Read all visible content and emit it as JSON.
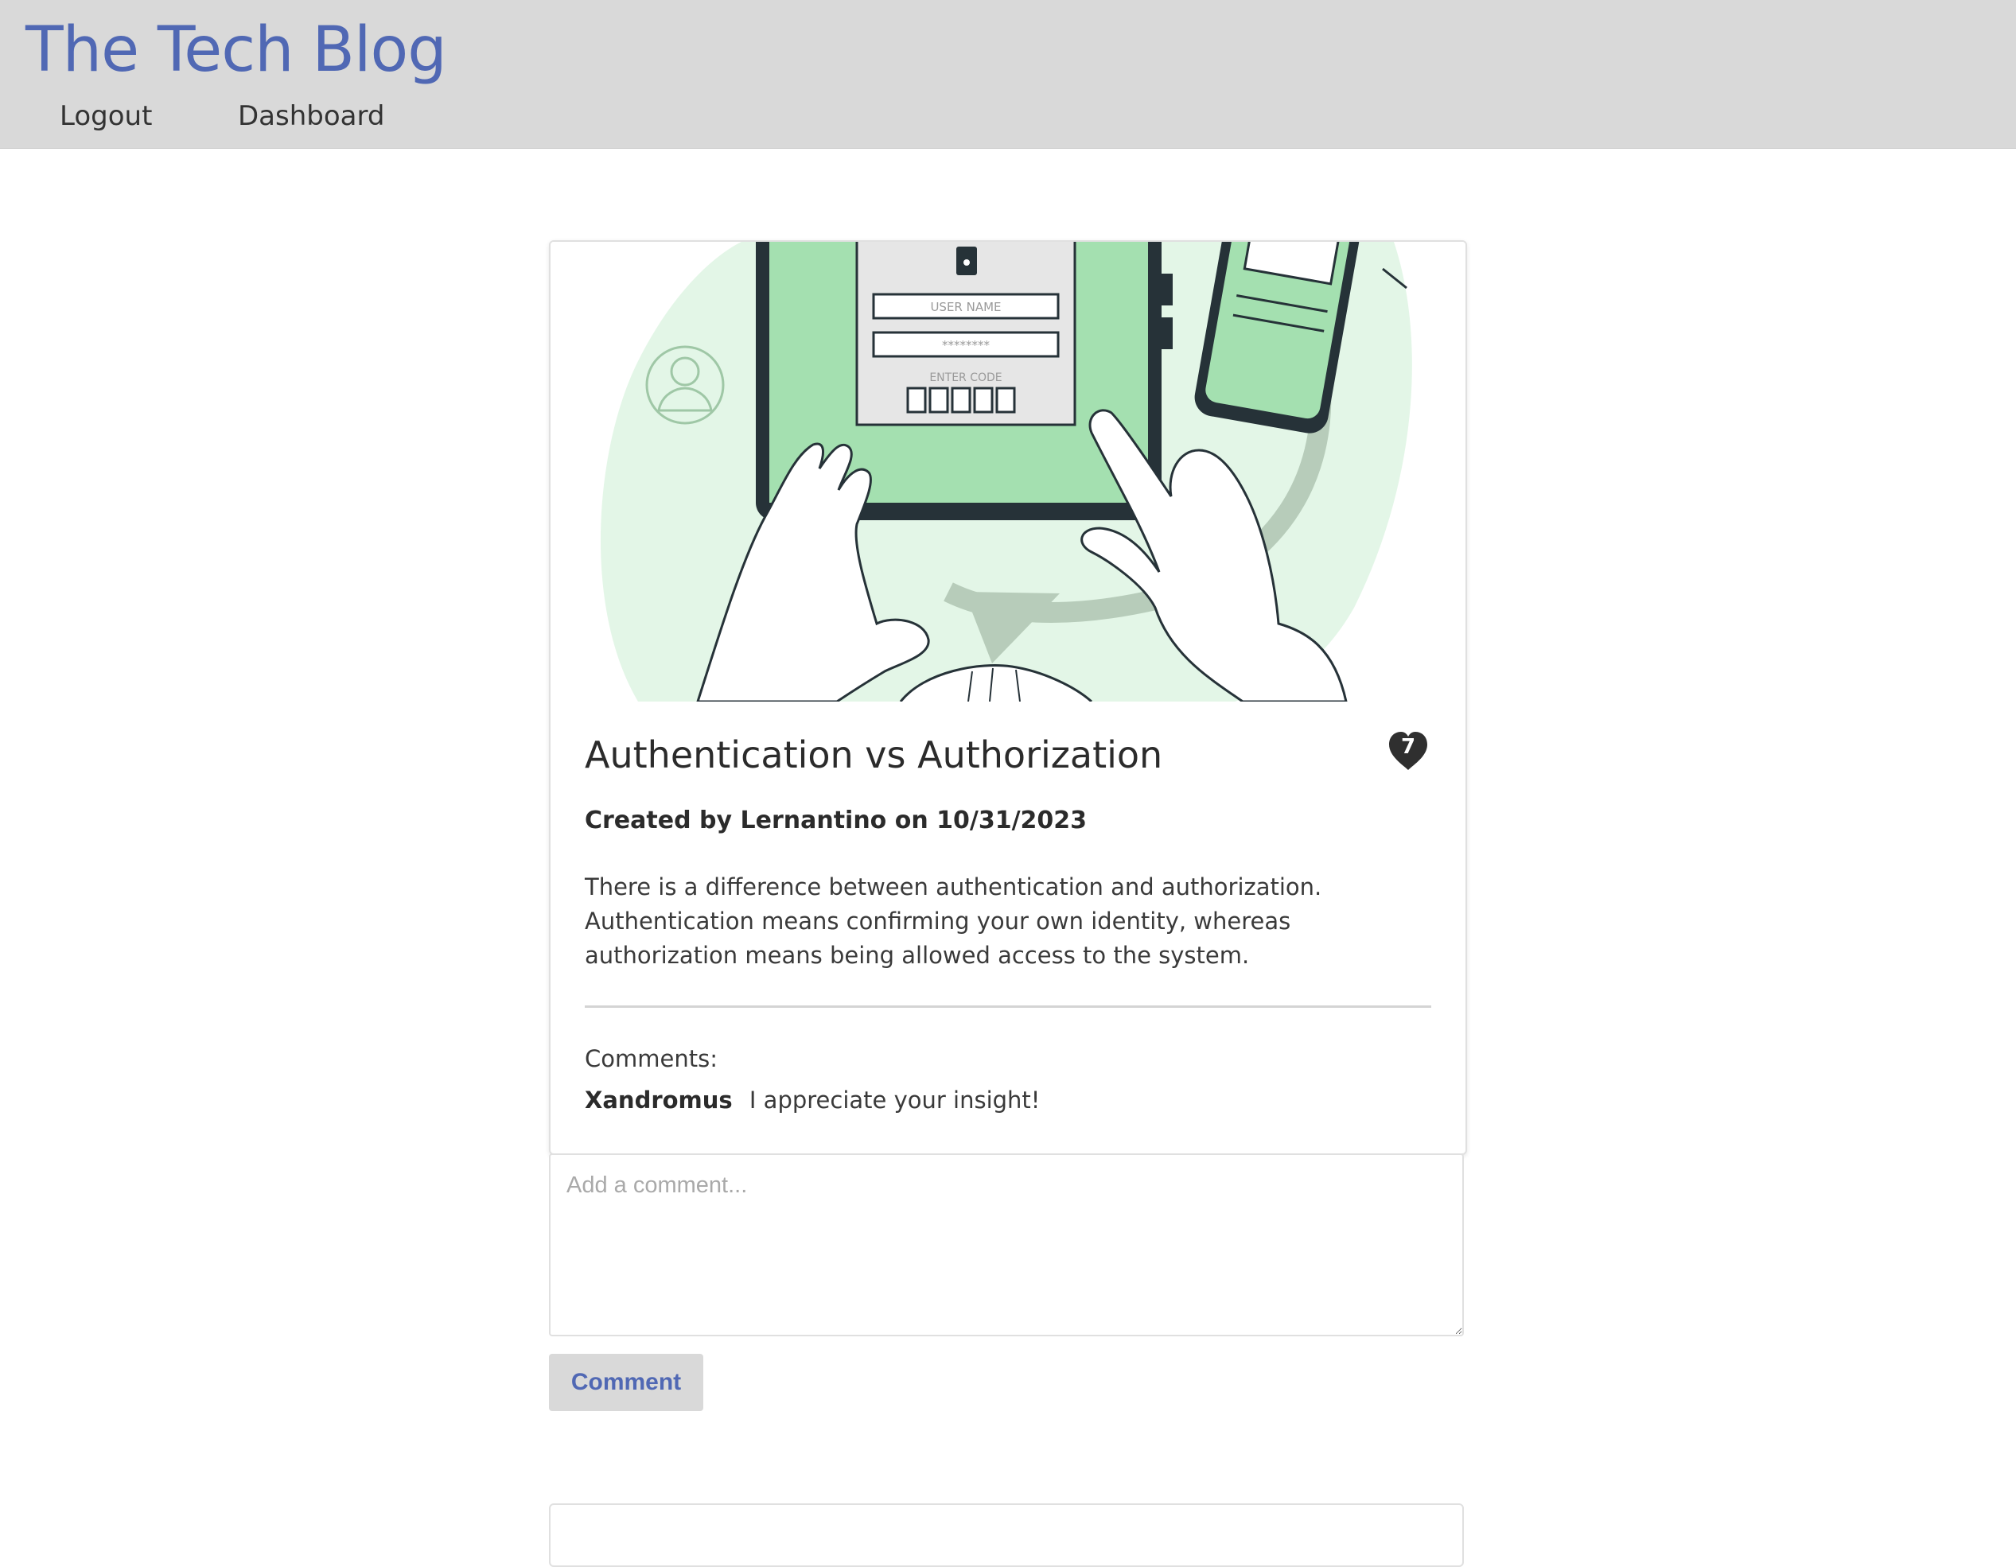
{
  "header": {
    "site_title": "The Tech Blog",
    "nav": [
      {
        "label": "Logout"
      },
      {
        "label": "Dashboard"
      }
    ]
  },
  "post": {
    "image_text": {
      "username_field": "USER NAME",
      "password_field": "********",
      "code_label": "ENTER CODE"
    },
    "title": "Authentication vs Authorization",
    "like_count": "7",
    "meta": "Created by Lernantino on 10/31/2023",
    "body": "There is a difference between authentication and authorization. Authentication means confirming your own identity, whereas authorization means being allowed access to the system.",
    "comments_heading": "Comments:",
    "comments": [
      {
        "author": "Xandromus",
        "text": "I appreciate your insight!"
      }
    ]
  },
  "comment_form": {
    "placeholder": "Add a comment...",
    "value": "",
    "submit_label": "Comment"
  },
  "colors": {
    "accent": "#5068b4",
    "header_bg": "#d9d9d9",
    "illustration_green": "#a4e0b0",
    "illustration_light_green": "#e3f6e7",
    "illustration_dark": "#263238"
  }
}
